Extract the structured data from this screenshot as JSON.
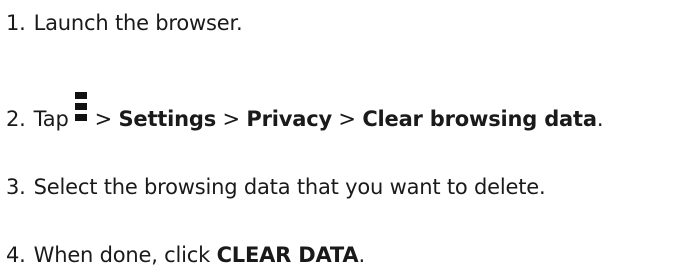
{
  "steps": [
    {
      "number": "1.",
      "text": "Launch the browser."
    },
    {
      "number": "2.",
      "prefix": "Tap",
      "icon": "overflow-menu-icon",
      "separator": ">",
      "settings": "Settings",
      "privacy": "Privacy",
      "clear_browsing_data": "Clear browsing data",
      "end": "."
    },
    {
      "number": "3.",
      "text": "Select the browsing data that you want to delete."
    },
    {
      "number": "4.",
      "prefix": "When done, click",
      "button": "CLEAR DATA",
      "end": "."
    }
  ]
}
